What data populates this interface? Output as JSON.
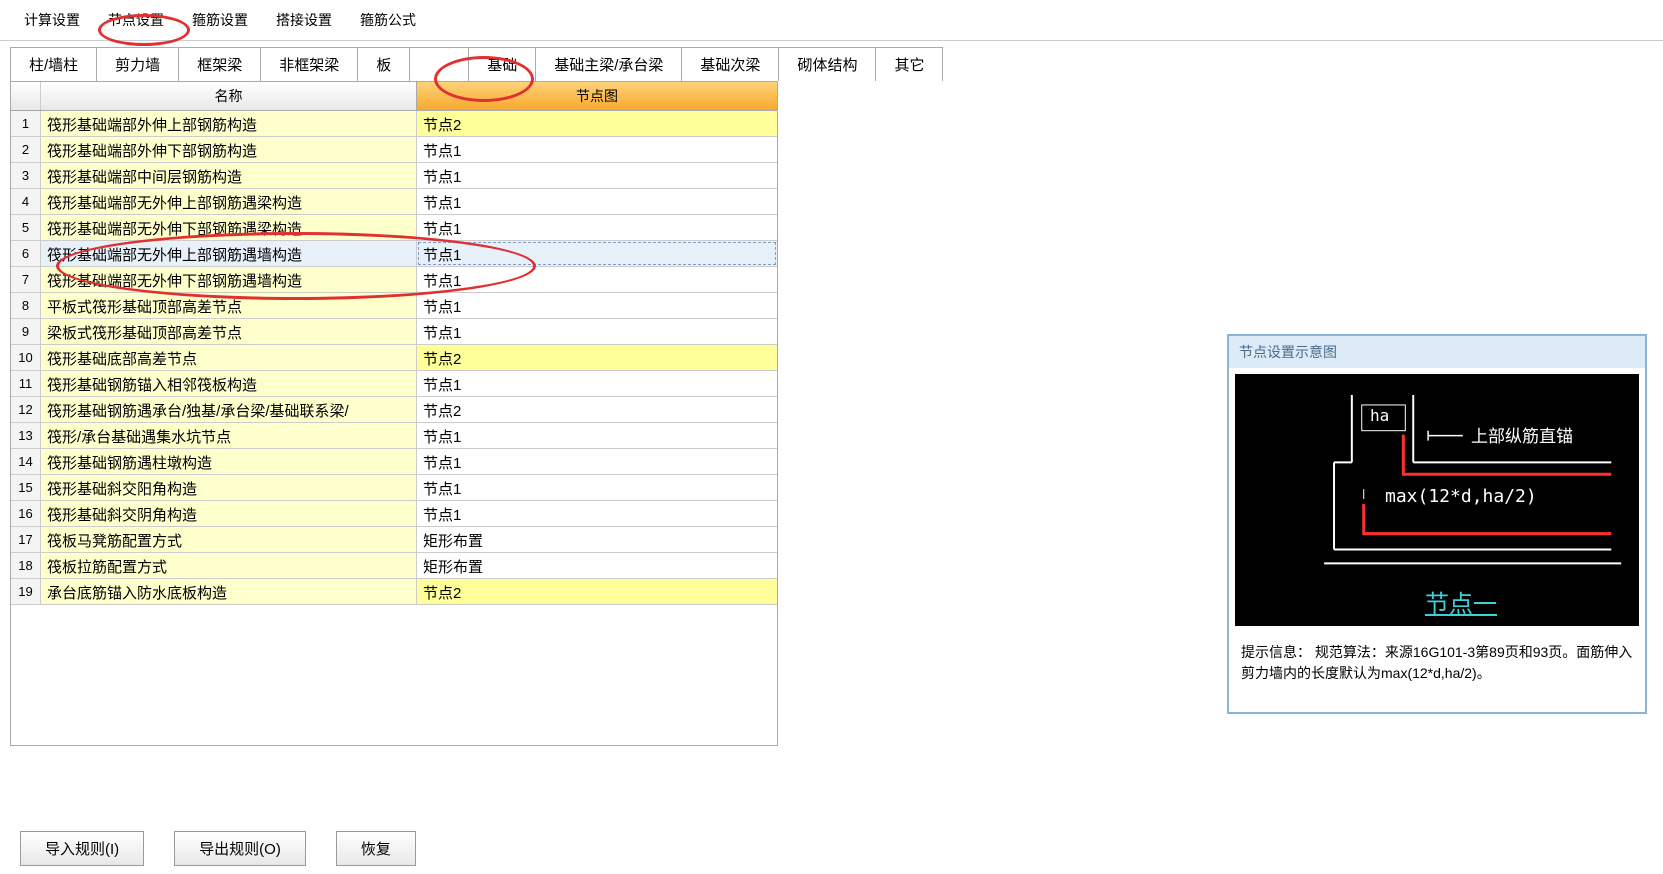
{
  "menubar": {
    "calc_settings": "计算设置",
    "node_settings": "节点设置",
    "rebar_settings": "箍筋设置",
    "lap_settings": "搭接设置",
    "stirrup_formula": "箍筋公式"
  },
  "tabs": {
    "column_wall": "柱/墙柱",
    "shear_wall": "剪力墙",
    "frame_beam": "框架梁",
    "non_frame_beam": "非框架梁",
    "slab": "板",
    "foundation": "基础",
    "foundation_main_beam": "基础主梁/承台梁",
    "foundation_secondary_beam": "基础次梁",
    "masonry": "砌体结构",
    "other": "其它"
  },
  "table": {
    "header_name": "名称",
    "header_node": "节点图",
    "rows": [
      {
        "n": "1",
        "name": "筏形基础端部外伸上部钢筋构造",
        "node": "节点2",
        "hl": true
      },
      {
        "n": "2",
        "name": "筏形基础端部外伸下部钢筋构造",
        "node": "节点1"
      },
      {
        "n": "3",
        "name": "筏形基础端部中间层钢筋构造",
        "node": "节点1"
      },
      {
        "n": "4",
        "name": "筏形基础端部无外伸上部钢筋遇梁构造",
        "node": "节点1"
      },
      {
        "n": "5",
        "name": "筏形基础端部无外伸下部钢筋遇梁构造",
        "node": "节点1"
      },
      {
        "n": "6",
        "name": "筏形基础端部无外伸上部钢筋遇墙构造",
        "node": "节点1",
        "sel": true
      },
      {
        "n": "7",
        "name": "筏形基础端部无外伸下部钢筋遇墙构造",
        "node": "节点1"
      },
      {
        "n": "8",
        "name": "平板式筏形基础顶部高差节点",
        "node": "节点1"
      },
      {
        "n": "9",
        "name": "梁板式筏形基础顶部高差节点",
        "node": "节点1"
      },
      {
        "n": "10",
        "name": "筏形基础底部高差节点",
        "node": "节点2",
        "hl": true
      },
      {
        "n": "11",
        "name": "筏形基础钢筋锚入相邻筏板构造",
        "node": "节点1"
      },
      {
        "n": "12",
        "name": "筏形基础钢筋遇承台/独基/承台梁/基础联系梁/",
        "node": "节点2"
      },
      {
        "n": "13",
        "name": "筏形/承台基础遇集水坑节点",
        "node": "节点1"
      },
      {
        "n": "14",
        "name": "筏形基础钢筋遇柱墩构造",
        "node": "节点1"
      },
      {
        "n": "15",
        "name": "筏形基础斜交阳角构造",
        "node": "节点1"
      },
      {
        "n": "16",
        "name": "筏形基础斜交阴角构造",
        "node": "节点1"
      },
      {
        "n": "17",
        "name": "筏板马凳筋配置方式",
        "node": "矩形布置"
      },
      {
        "n": "18",
        "name": "筏板拉筋配置方式",
        "node": "矩形布置"
      },
      {
        "n": "19",
        "name": "承台底筋锚入防水底板构造",
        "node": "节点2",
        "hl": true
      }
    ]
  },
  "diagram": {
    "title": "节点设置示意图",
    "ha": "ha",
    "upper_anchor": "上部纵筋直锚",
    "formula": "max(12*d,ha/2)",
    "node_label": "节点一",
    "info_prefix": "提示信息：",
    "info_text": "规范算法：来源16G101-3第89页和93页。面筋伸入剪力墙内的长度默认为max(12*d,ha/2)。"
  },
  "buttons": {
    "import": "导入规则(I)",
    "export": "导出规则(O)",
    "restore": "恢复"
  }
}
